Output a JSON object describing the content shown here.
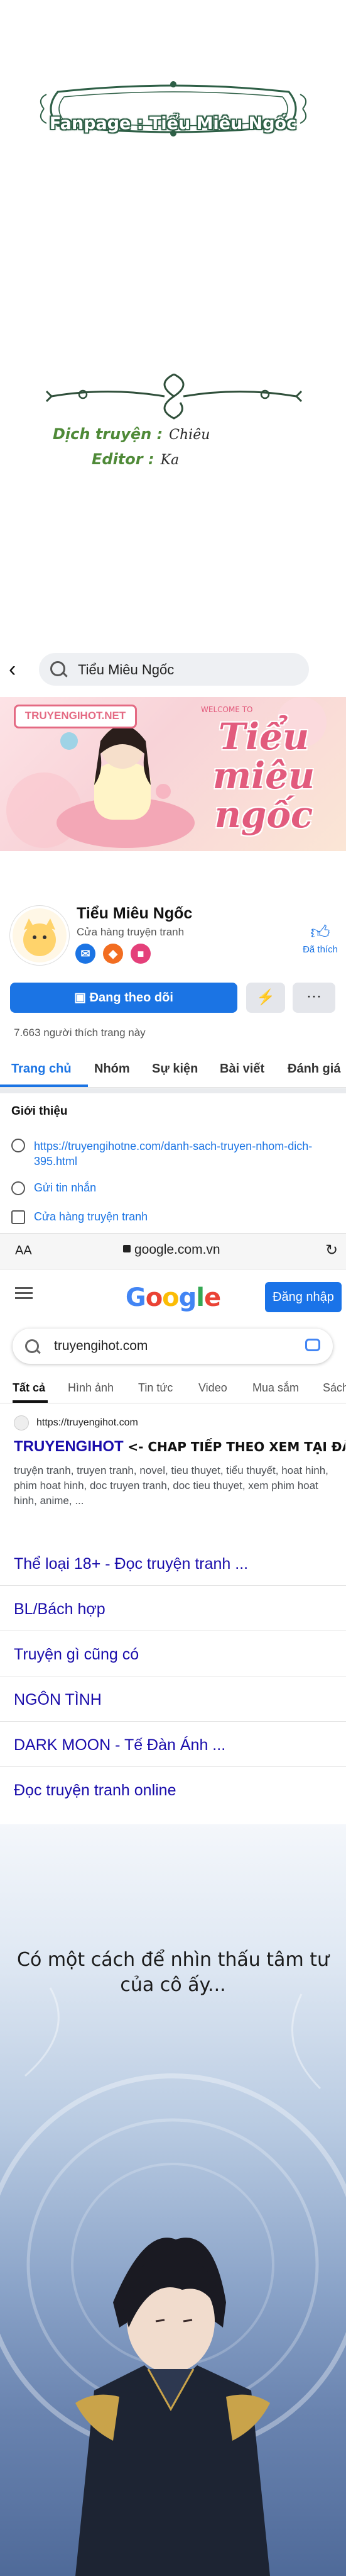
{
  "credits": {
    "fanpage": "Fanpage : Tiểu Miêu Ngốc",
    "translator_label": "Dịch truyện :",
    "editor_label": "Editor :",
    "translator_signature": "Chiêu",
    "editor_signature": "Ka"
  },
  "facebook": {
    "search_query": "Tiểu Miêu Ngốc",
    "cover_badge": "TRUYENGIHOT.NET",
    "cover_script": "Tiểu miêu ngốc",
    "cover_welcome": "WELCOME TO",
    "page_name": "Tiểu Miêu Ngốc",
    "page_category": "Cửa hàng truyện tranh",
    "like_label": "Đã thích",
    "follow_button": "Đang theo dõi",
    "likes_count": "7.663 người thích trang này",
    "tabs": [
      "Trang chủ",
      "Nhóm",
      "Sự kiện",
      "Bài viết",
      "Đánh giá"
    ],
    "intro_title": "Giới thiệu",
    "intro_link": "https://truyengihotne.com/danh-sach-truyen-nhom-dich-395.html",
    "intro_message": "Gửi tin nhắn",
    "intro_category": "Cửa hàng truyện tranh"
  },
  "browser": {
    "aa": "AA",
    "url": "google.com.vn"
  },
  "google": {
    "logo_letters": [
      "G",
      "o",
      "o",
      "g",
      "l",
      "e"
    ],
    "logo_colors": [
      "#4285f4",
      "#ea4335",
      "#fbbc05",
      "#4285f4",
      "#34a853",
      "#ea4335"
    ],
    "signin_button": "Đăng nhập",
    "query": "truyengihot.com",
    "tabs": [
      "Tất cả",
      "Hình ảnh",
      "Tin tức",
      "Video",
      "Mua sắm",
      "Sách"
    ],
    "result_site": "https://truyengihot.com",
    "result_title_prefix": "TRUYENGIHOT",
    "result_title_suffix": "<- CHAP TIẾP THEO XEM TẠI ĐÂY NHA",
    "result_snippet": "truyện tranh, truyen tranh, novel, tieu thuyet, tiểu thuyết, hoat hinh, phim hoat hinh, doc truyen tranh, doc tieu thuyet, xem phim hoat hinh, anime, ...",
    "sublinks": [
      "Thể loại 18+ - Đọc truyện tranh ...",
      "BL/Bách hợp",
      "Truyện gì cũng có",
      "NGÔN TÌNH",
      "DARK MOON - Tế Đàn Ánh ...",
      "Đọc truyện tranh online"
    ]
  },
  "comic": {
    "speech": "Có một cách để nhìn thấu tâm tư của cô ấy..."
  },
  "colors": {
    "fb_blue": "#1b74e4",
    "google_blue": "#1a73e8",
    "link_blue": "#1a0dab",
    "credit_green": "#4f8a38"
  }
}
